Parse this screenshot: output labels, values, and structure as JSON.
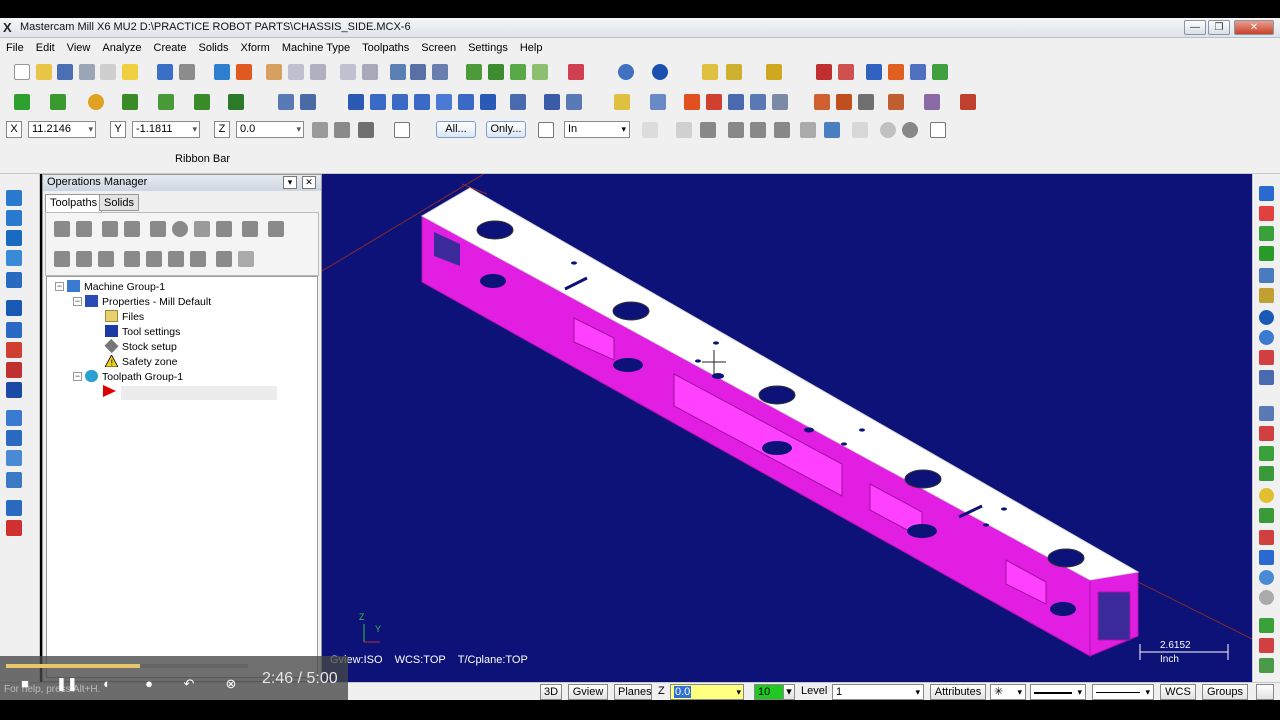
{
  "window": {
    "title": "Mastercam Mill X6 MU2  D:\\PRACTICE ROBOT PARTS\\CHASSIS_SIDE.MCX-6",
    "minimize": "—",
    "restore": "❐",
    "close": "✕"
  },
  "menu": [
    "File",
    "Edit",
    "View",
    "Analyze",
    "Create",
    "Solids",
    "Xform",
    "Machine Type",
    "Toolpaths",
    "Screen",
    "Settings",
    "Help"
  ],
  "ribbon": {
    "x_label": "X",
    "x_value": "11.2146",
    "y_label": "Y",
    "y_value": "-1.1811",
    "z_label": "Z",
    "z_value": "0.0",
    "all_button": "All...",
    "only_button": "Only...",
    "unit_select": "In",
    "ribbon_bar_label": "Ribbon Bar"
  },
  "ops_manager": {
    "title": "Operations Manager",
    "tabs": [
      "Toolpaths",
      "Solids"
    ],
    "tree": {
      "machine_group": "Machine Group-1",
      "properties": "Properties - Mill Default",
      "files": "Files",
      "tool_settings": "Tool settings",
      "stock_setup": "Stock setup",
      "safety_zone": "Safety zone",
      "toolpath_group": "Toolpath Group-1"
    }
  },
  "viewport": {
    "gview": "Gview:ISO",
    "wcs": "WCS:TOP",
    "tcplane": "T/Cplane:TOP",
    "scale_value": "2.6152",
    "scale_unit": "Inch",
    "background_color": "#0c1278",
    "part_color": "#e21ee2",
    "top_color": "#ffffff"
  },
  "status_bar": {
    "btn_3d": "3D",
    "gview_button": "Gview",
    "planes_button": "Planes",
    "z_label": "Z",
    "z_value": "0.0",
    "color_value": "10",
    "level_label": "Level",
    "level_value": "1",
    "attributes_button": "Attributes",
    "wcs_button": "WCS",
    "groups_button": "Groups"
  },
  "video": {
    "time": "2:46 / 5:00",
    "help_text": "For help, press Alt+H.",
    "progress": 0.553
  }
}
